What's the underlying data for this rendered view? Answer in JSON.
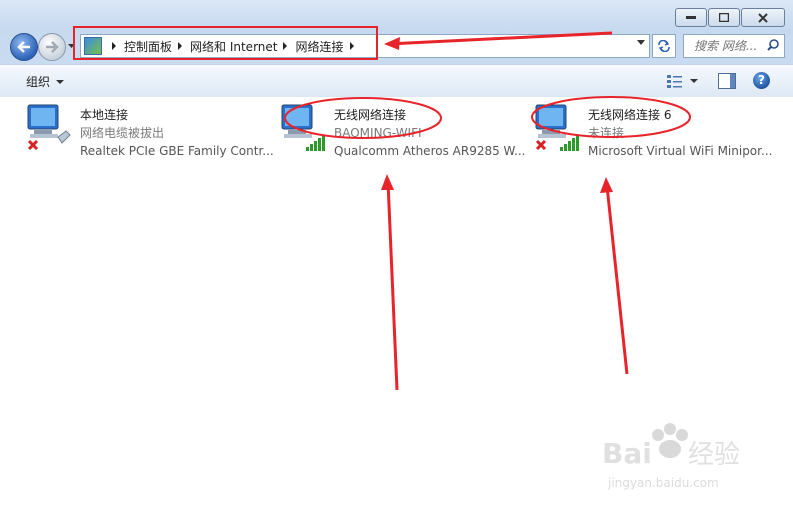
{
  "window": {
    "address": {
      "crumbs": [
        "控制面板",
        "网络和 Internet",
        "网络连接"
      ]
    },
    "search": {
      "placeholder": "搜索 网络..."
    }
  },
  "commandbar": {
    "organize_label": "组织"
  },
  "help_label": "?",
  "connections": [
    {
      "name": "本地连接",
      "status": "网络电缆被拔出",
      "adapter": "Realtek PCIe GBE Family Contr..."
    },
    {
      "name": "无线网络连接",
      "status": "BAOMING-WIFI",
      "adapter": "Qualcomm Atheros AR9285 W..."
    },
    {
      "name": "无线网络连接 6",
      "status": "未连接",
      "adapter": "Microsoft Virtual WiFi Minipor..."
    }
  ],
  "annotation_colors": {
    "highlight": "#e8242b"
  },
  "watermark": {
    "brand": "Baidu经验",
    "url": "jingyan.baidu.com"
  }
}
